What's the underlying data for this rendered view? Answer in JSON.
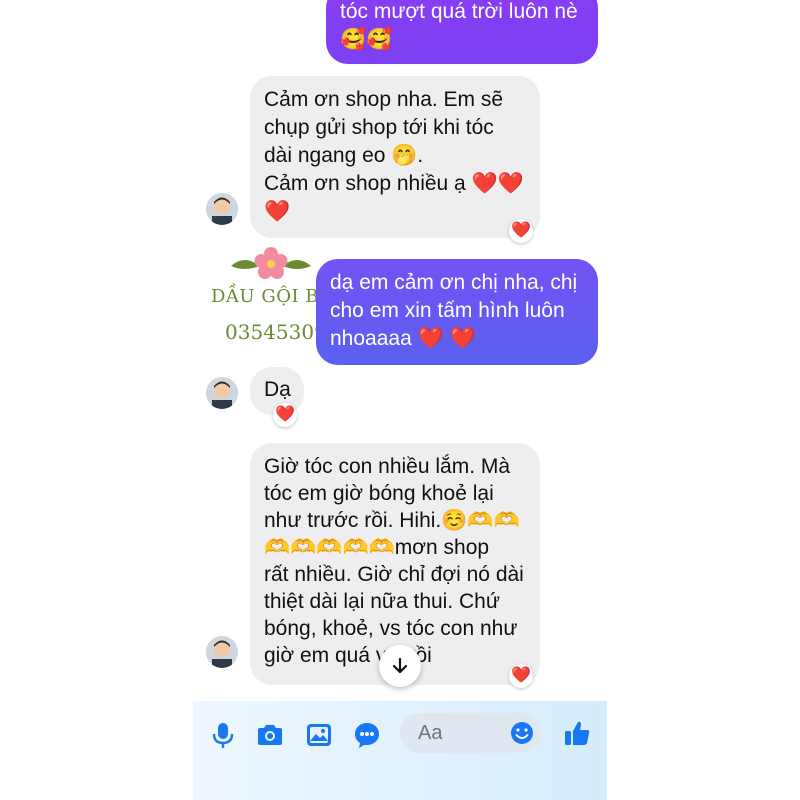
{
  "messages": [
    {
      "id": "m1",
      "dir": "out",
      "lines": [
        "tóc mượt quá trời luôn nè",
        "🥰🥰"
      ]
    },
    {
      "id": "m2",
      "dir": "in",
      "lines": [
        "Cảm ơn shop nha. Em sẽ",
        "chụp gửi shop tới khi tóc",
        "dài ngang eo 🤭.",
        "Cảm ơn shop nhiều ạ ❤️❤️",
        "❤️"
      ],
      "reaction": "❤️"
    },
    {
      "id": "m3",
      "dir": "out",
      "lines": [
        "dạ em cảm ơn chị nha, chị",
        "cho em xin tấm hình luôn",
        "nhoaaaa ❤️ ❤️"
      ]
    },
    {
      "id": "m4",
      "dir": "in",
      "lines": [
        "Dạ"
      ],
      "reaction": "❤️"
    },
    {
      "id": "m5",
      "dir": "in",
      "lines": [
        "Giờ tóc con nhiều lắm. Mà",
        "tóc em giờ bóng khoẻ lại",
        "như trước rồi. Hihi.☺️🫶🫶",
        "🫶🫶🫶🫶🫶mơn shop",
        "rất nhiều. Giờ chỉ đợi nó dài",
        "thiệt dài lại nữa thui. Chứ",
        "bóng, khoẻ, vs tóc con như",
        "giờ em quá vui rồi"
      ],
      "reaction": "❤️"
    }
  ],
  "watermark": {
    "line1": "DẦU GỘI BỒ KẾT",
    "line2": "0354530979"
  },
  "composer": {
    "placeholder": "Aa"
  },
  "icons": {
    "mic": "microphone-icon",
    "camera": "camera-icon",
    "gallery": "image-icon",
    "more": "chat-bubble-icon",
    "emoji": "smile-icon",
    "like": "thumbs-up-icon",
    "scroll": "arrow-down-icon"
  },
  "colors": {
    "accent": "#1877f2",
    "heart": "#e8253b",
    "bubble_in": "#eeeef0"
  }
}
